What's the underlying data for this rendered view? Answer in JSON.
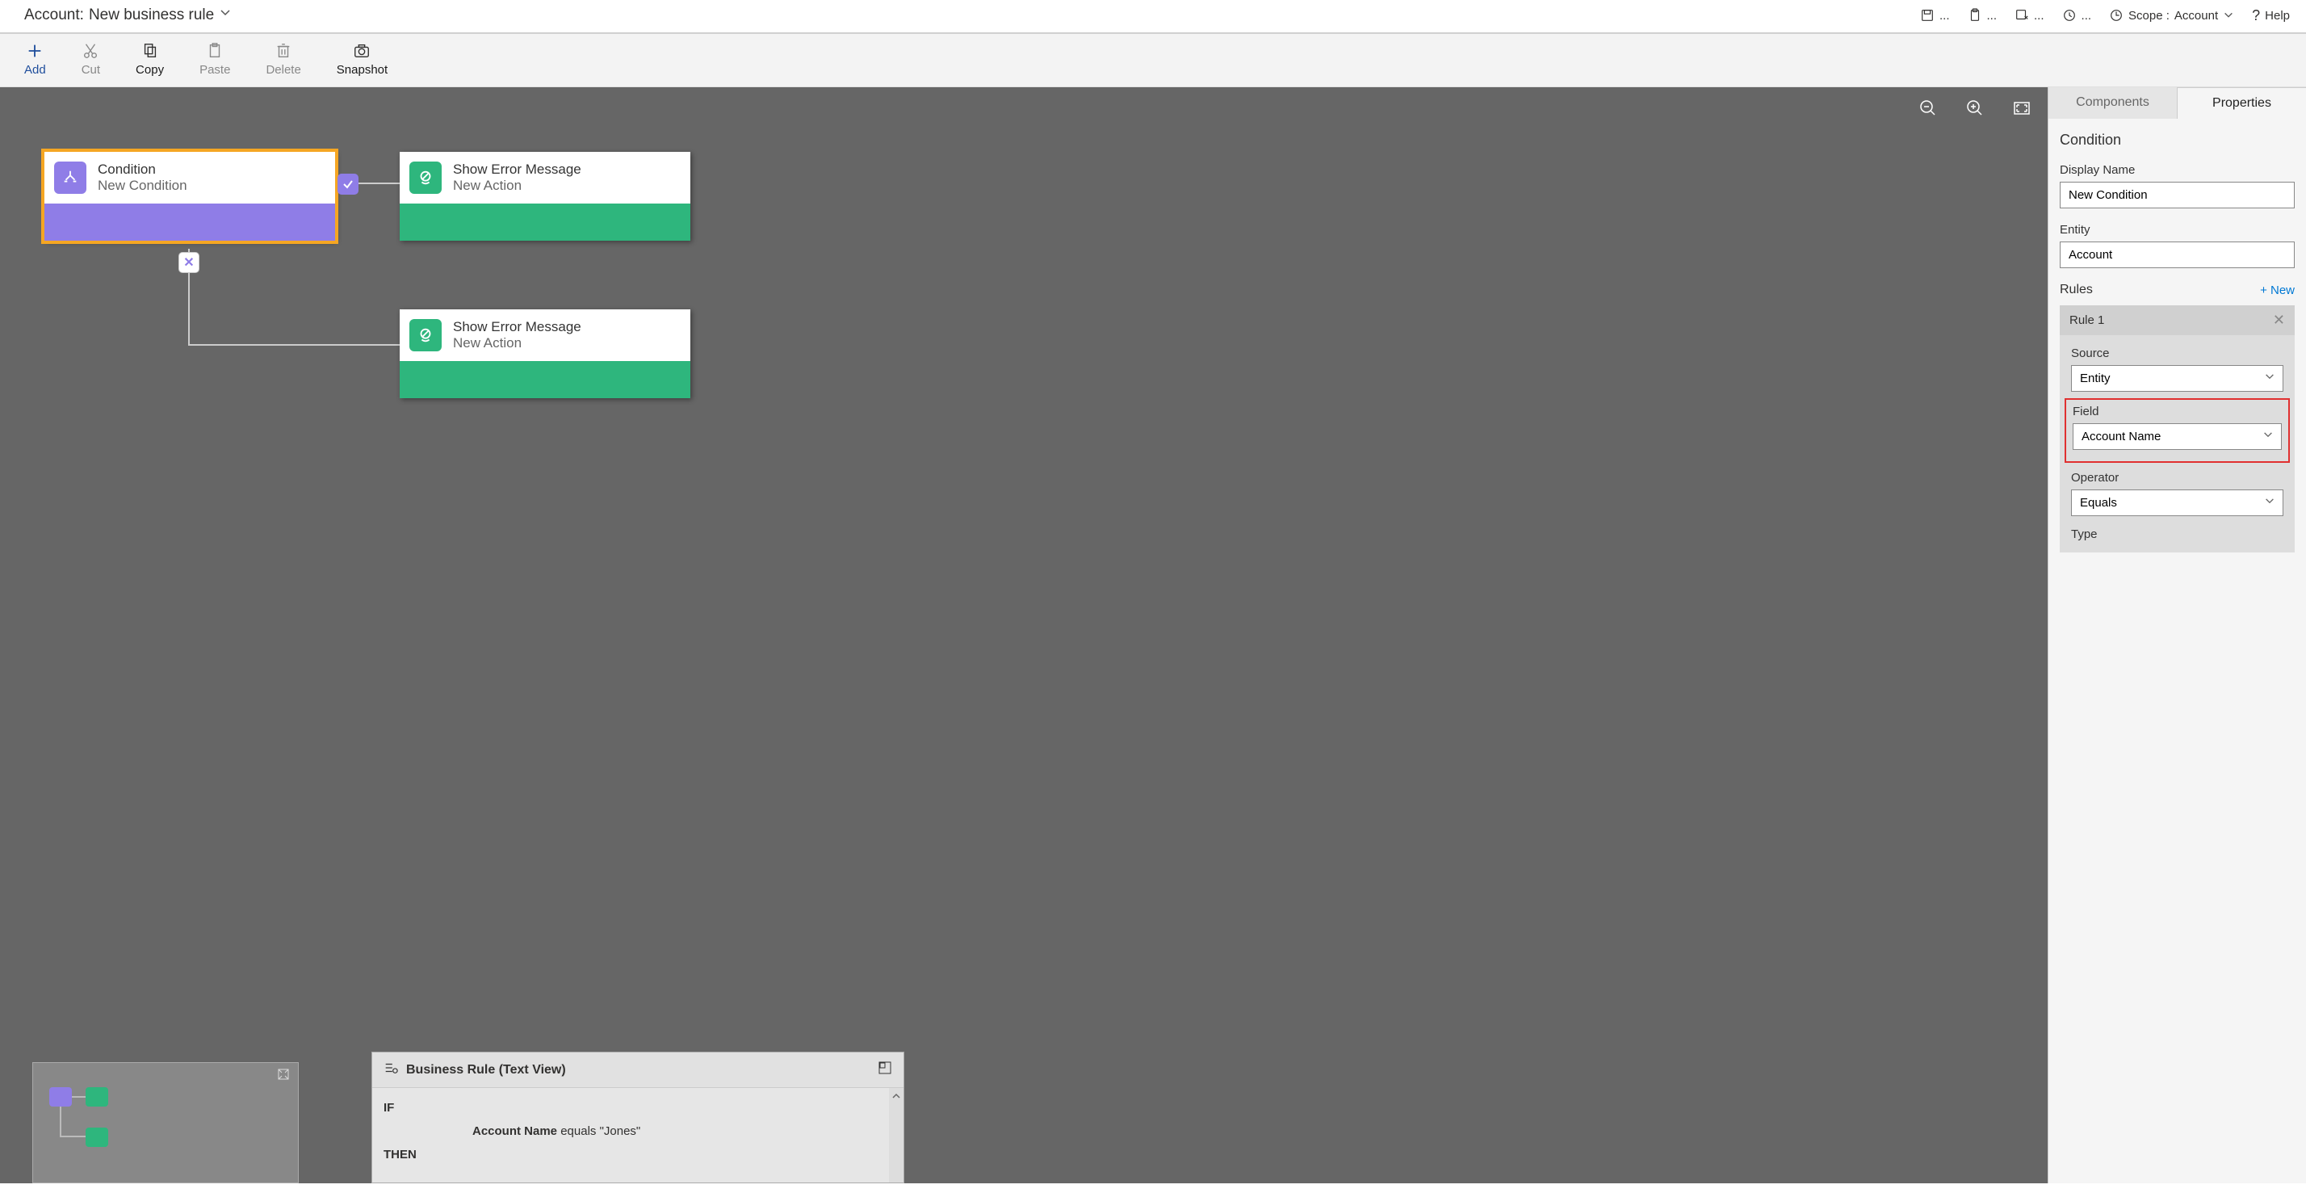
{
  "header": {
    "title_prefix": "Account:",
    "title_name": "New business rule",
    "scope_label": "Scope :",
    "scope_value": "Account",
    "help": "Help"
  },
  "toolbar": {
    "add": "Add",
    "cut": "Cut",
    "copy": "Copy",
    "paste": "Paste",
    "delete": "Delete",
    "snapshot": "Snapshot"
  },
  "canvas": {
    "condition_node": {
      "title": "Condition",
      "sub": "New Condition"
    },
    "action1": {
      "title": "Show Error Message",
      "sub": "New Action"
    },
    "action2": {
      "title": "Show Error Message",
      "sub": "New Action"
    }
  },
  "textview": {
    "title": "Business Rule (Text View)",
    "if": "IF",
    "then": "THEN",
    "cond_field": "Account Name",
    "cond_rest": " equals \"Jones\""
  },
  "panel": {
    "tabs": {
      "components": "Components",
      "properties": "Properties"
    },
    "section": "Condition",
    "display_name_label": "Display Name",
    "display_name_value": "New Condition",
    "entity_label": "Entity",
    "entity_value": "Account",
    "rules_label": "Rules",
    "new_link": "+  New",
    "rule_title": "Rule 1",
    "source_label": "Source",
    "source_value": "Entity",
    "field_label": "Field",
    "field_value": "Account Name",
    "operator_label": "Operator",
    "operator_value": "Equals",
    "type_label": "Type"
  }
}
